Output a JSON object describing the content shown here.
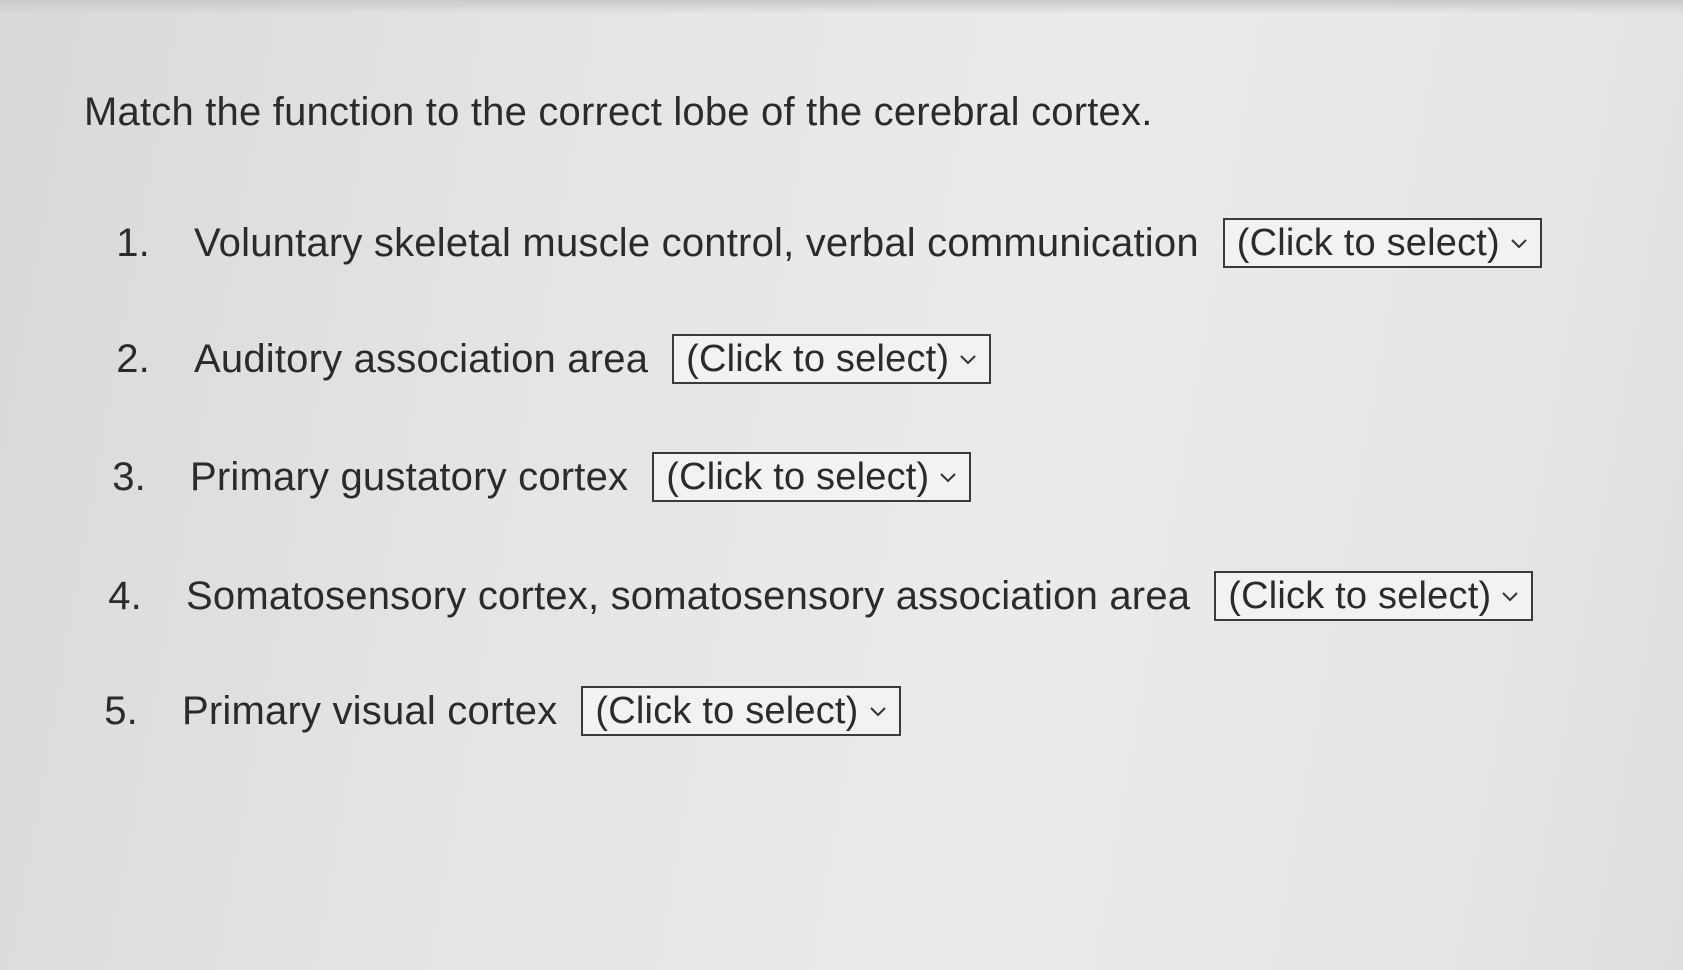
{
  "question": {
    "prompt": "Match the function to the correct lobe of the cerebral cortex."
  },
  "items": [
    {
      "number": "1.",
      "label": "Voluntary skeletal muscle control, verbal communication",
      "select": "(Click to select)"
    },
    {
      "number": "2.",
      "label": "Auditory association area",
      "select": "(Click to select)"
    },
    {
      "number": "3.",
      "label": "Primary gustatory cortex",
      "select": "(Click to select)"
    },
    {
      "number": "4.",
      "label": "Somatosensory cortex, somatosensory association area",
      "select": "(Click to select)"
    },
    {
      "number": "5.",
      "label": "Primary visual cortex",
      "select": "(Click to select)"
    }
  ],
  "icons": {
    "dropdown": "chevron-down-icon"
  }
}
